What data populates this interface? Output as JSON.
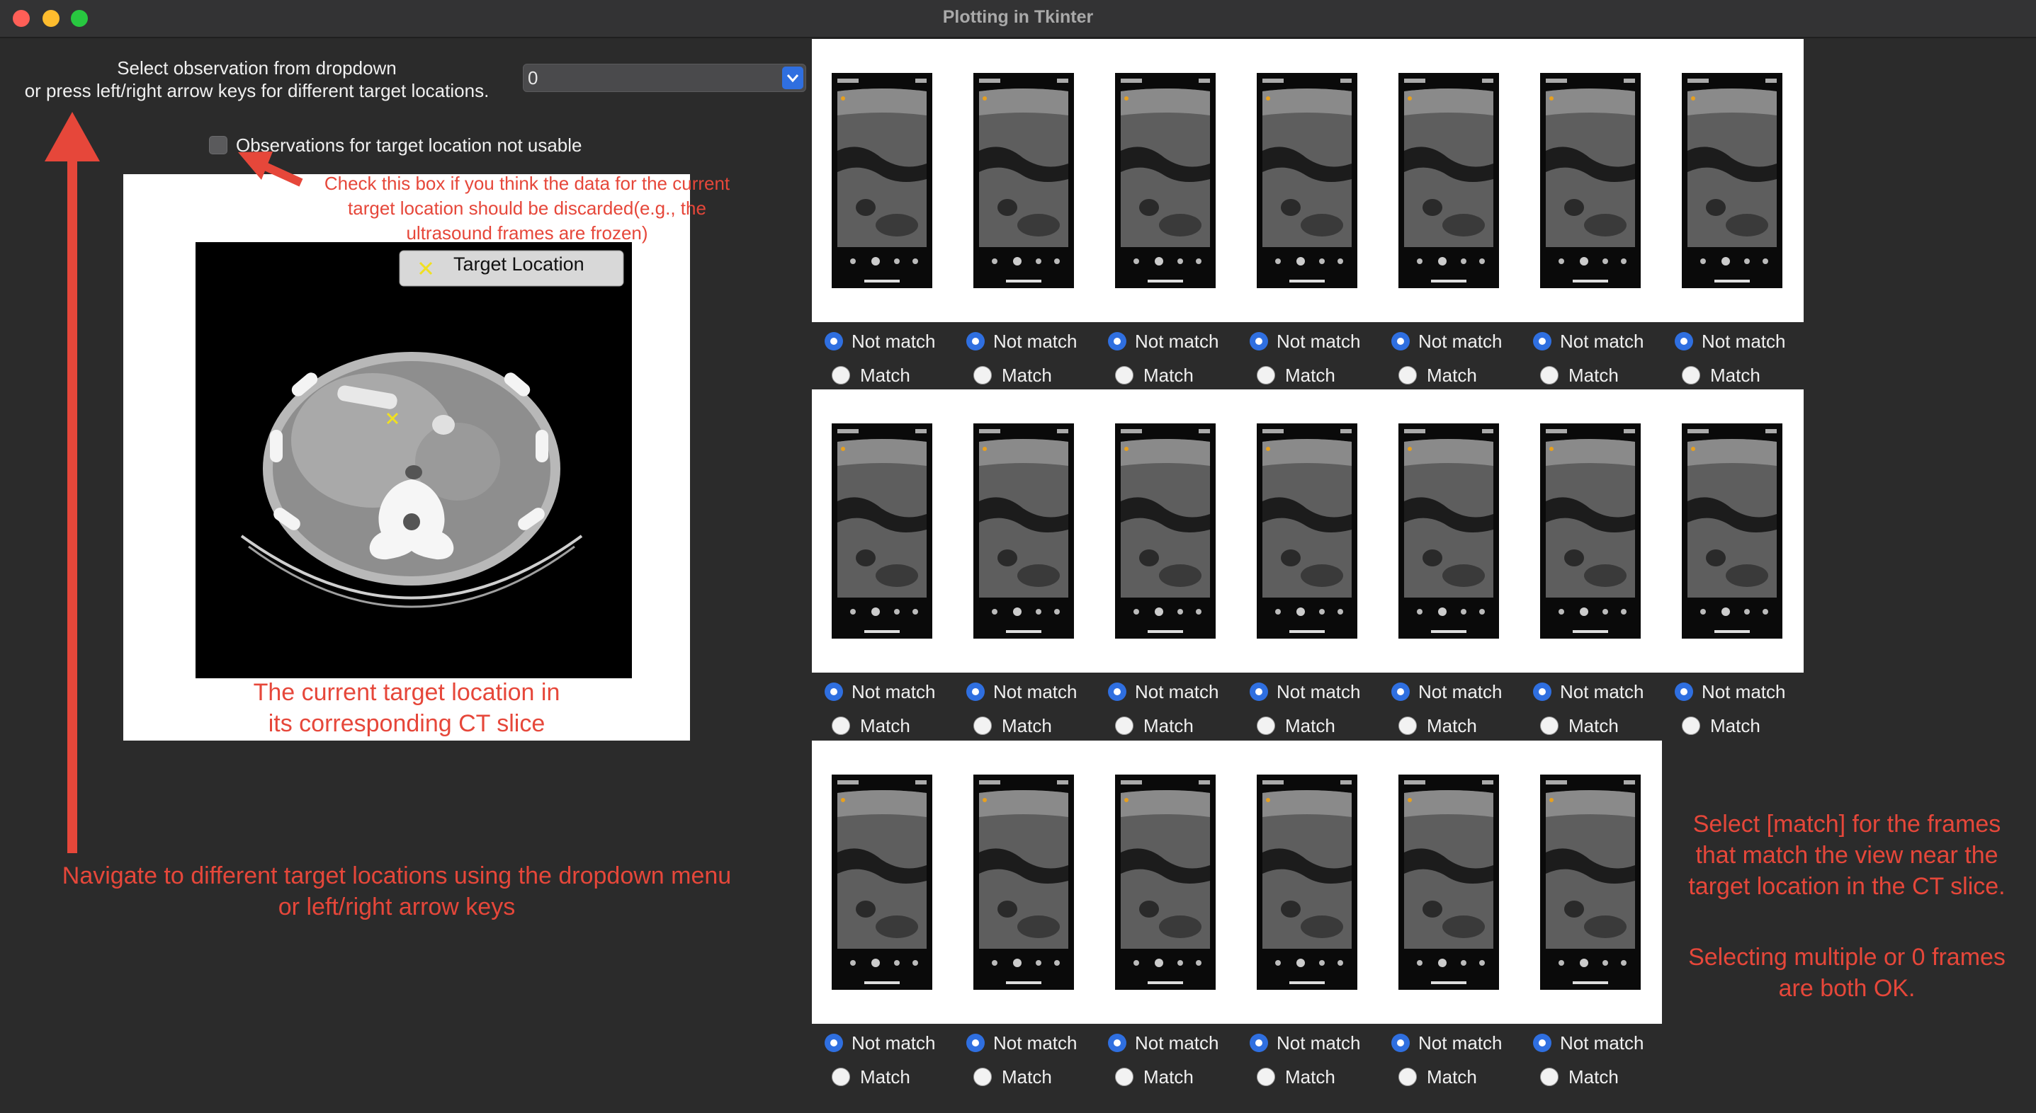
{
  "window": {
    "title": "Plotting in Tkinter"
  },
  "traffic_lights": {
    "close": "#ff5f57",
    "minimize": "#febc2e",
    "zoom": "#28c840"
  },
  "controls": {
    "dropdown_label": [
      "Select observation from dropdown",
      "or press left/right arrow keys for different target locations."
    ],
    "dropdown_value": "0",
    "checkbox_label": "Observations for target location not usable",
    "checkbox_checked": false
  },
  "ct_plot": {
    "legend_label": "Target Location",
    "legend_marker": "×"
  },
  "annotations": {
    "checkbox_note": [
      "Check this box if you think the data for the current",
      "target location should be discarded(e.g., the",
      "ultrasound frames are frozen)"
    ],
    "ct_caption": [
      "The current target location in",
      "its corresponding CT slice"
    ],
    "navigate_note": [
      "Navigate to different target locations using the dropdown menu",
      "or left/right arrow keys"
    ],
    "match_note": [
      "Select [match] for the frames",
      "that match the view near the",
      "target location in the CT slice."
    ],
    "multi_note": [
      "Selecting multiple or 0 frames",
      "are both OK."
    ]
  },
  "radio_labels": {
    "not_match": "Not match",
    "match": "Match"
  },
  "frame_rows": [
    {
      "count": 7,
      "selection": [
        "Not match",
        "Not match",
        "Not match",
        "Not match",
        "Not match",
        "Not match",
        "Not match"
      ]
    },
    {
      "count": 7,
      "selection": [
        "Not match",
        "Not match",
        "Not match",
        "Not match",
        "Not match",
        "Not match",
        "Not match"
      ]
    },
    {
      "count": 6,
      "selection": [
        "Not match",
        "Not match",
        "Not match",
        "Not match",
        "Not match",
        "Not match"
      ]
    }
  ],
  "colors": {
    "accent": "#2f6fe0",
    "annotation": "#e6473a",
    "background": "#2b2b2b"
  }
}
